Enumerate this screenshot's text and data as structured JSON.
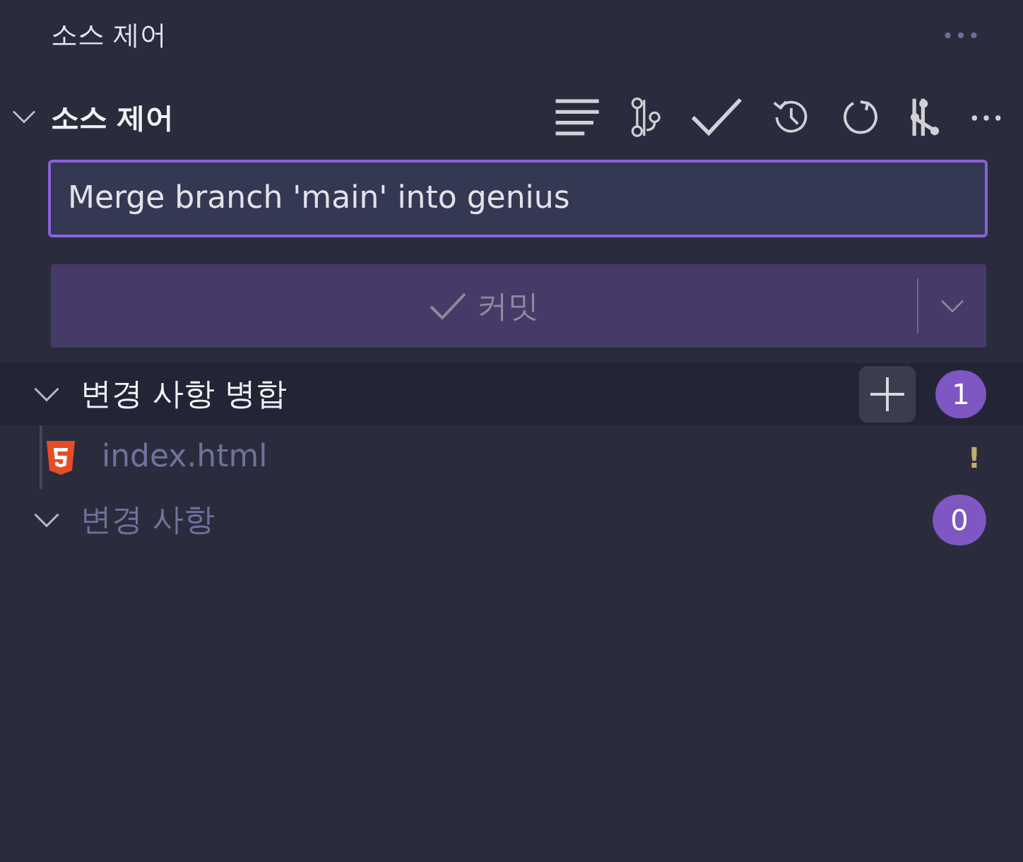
{
  "panel": {
    "title": "소스 제어"
  },
  "section": {
    "title": "소스 제어",
    "expanded": true
  },
  "commit_message": {
    "value": "Merge branch 'main' into genius"
  },
  "commit_button": {
    "label": "커밋",
    "disabled": true
  },
  "groups": [
    {
      "title": "변경 사항 병합",
      "count": "1",
      "expanded": true,
      "selected": true,
      "files": [
        {
          "name": "index.html",
          "status": "!"
        }
      ]
    },
    {
      "title": "변경 사항",
      "count": "0",
      "expanded": true,
      "selected": false
    }
  ]
}
